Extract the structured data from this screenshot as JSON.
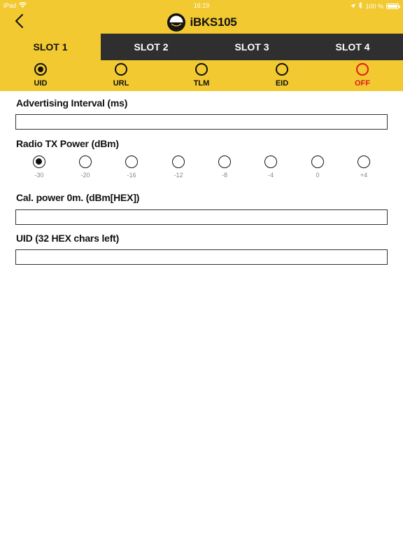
{
  "status_bar": {
    "carrier": "iPad",
    "wifi_icon": "wifi-icon",
    "time": "16:19",
    "location_icon": "location-arrow-icon",
    "bluetooth_icon": "bluetooth-icon",
    "battery": "100 %",
    "battery_icon": "battery-full-icon"
  },
  "nav": {
    "back_icon": "chevron-left-icon",
    "logo_icon": "beacon-logo-icon",
    "title": "iBKS105"
  },
  "slot_tabs": [
    {
      "label": "SLOT 1",
      "active": true
    },
    {
      "label": "SLOT 2",
      "active": false
    },
    {
      "label": "SLOT 3",
      "active": false
    },
    {
      "label": "SLOT 4",
      "active": false
    }
  ],
  "frame_types": [
    {
      "label": "UID",
      "selected": true
    },
    {
      "label": "URL",
      "selected": false
    },
    {
      "label": "TLM",
      "selected": false
    },
    {
      "label": "EID",
      "selected": false
    },
    {
      "label": "OFF",
      "selected": false
    }
  ],
  "form": {
    "advertising_interval_label": "Advertising Interval (ms)",
    "advertising_interval_value": "",
    "radio_tx_label": "Radio TX Power (dBm)",
    "tx_power_options": [
      {
        "label": "-30",
        "selected": true
      },
      {
        "label": "-20",
        "selected": false
      },
      {
        "label": "-16",
        "selected": false
      },
      {
        "label": "-12",
        "selected": false
      },
      {
        "label": "-8",
        "selected": false
      },
      {
        "label": "-4",
        "selected": false
      },
      {
        "label": "0",
        "selected": false
      },
      {
        "label": "+4",
        "selected": false
      }
    ],
    "cal_power_label": "Cal. power 0m. (dBm[HEX])",
    "cal_power_value": "",
    "uid_label": "UID (32 HEX chars left)",
    "uid_value": ""
  },
  "colors": {
    "accent": "#f2c930",
    "tab_dark": "#2f2f2f",
    "off_red": "#e01b1b"
  }
}
